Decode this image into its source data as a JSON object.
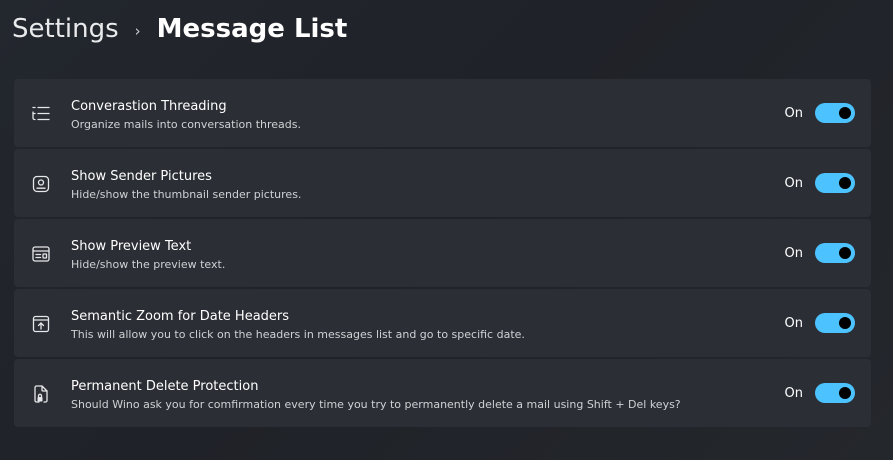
{
  "breadcrumb": {
    "parent": "Settings",
    "separator": "›",
    "current": "Message List"
  },
  "colors": {
    "accent": "#4cc2ff",
    "card_background": "#2b2e35"
  },
  "settings": [
    {
      "icon": "list-threading-icon",
      "title": "Converastion Threading",
      "description": "Organize mails into conversation threads.",
      "state_label": "On",
      "enabled": true
    },
    {
      "icon": "contact-picture-icon",
      "title": "Show Sender Pictures",
      "description": "Hide/show the thumbnail sender pictures.",
      "state_label": "On",
      "enabled": true
    },
    {
      "icon": "preview-window-icon",
      "title": "Show Preview Text",
      "description": "Hide/show the preview text.",
      "state_label": "On",
      "enabled": true
    },
    {
      "icon": "zoom-to-date-icon",
      "title": "Semantic Zoom for Date Headers",
      "description": "This will allow you to click on the headers in messages list and go to specific date.",
      "state_label": "On",
      "enabled": true
    },
    {
      "icon": "document-lock-icon",
      "title": "Permanent Delete Protection",
      "description": "Should Wino ask you for comfirmation every time you try to permanently delete a mail using Shift + Del keys?",
      "state_label": "On",
      "enabled": true
    }
  ]
}
